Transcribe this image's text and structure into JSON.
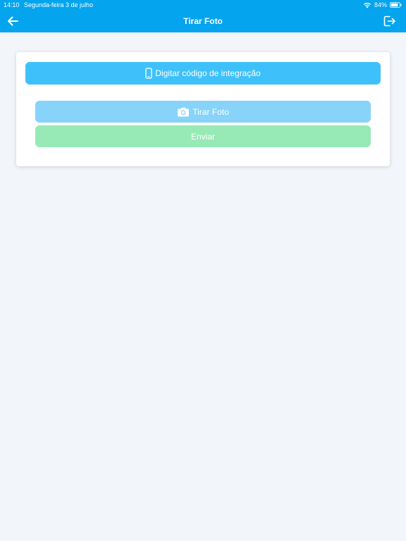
{
  "status_bar": {
    "time": "14:10",
    "date": "Segunda-feira 3 de julho",
    "battery": "84%",
    "icons": [
      "wifi-icon",
      "battery-icon"
    ]
  },
  "header": {
    "title": "Tirar Foto",
    "back_icon": "arrow-left-icon",
    "logout_icon": "logout-icon",
    "background_color": "#04a4ee"
  },
  "card": {
    "code_button": {
      "label": "Digitar código de integração",
      "icon": "smartphone-icon",
      "color": "#3ec1fb"
    },
    "photo_button": {
      "label": "Tirar Foto",
      "icon": "camera-icon",
      "color": "#87d3f9"
    },
    "send_button": {
      "label": "Enviar",
      "color": "#97e9b6"
    }
  }
}
